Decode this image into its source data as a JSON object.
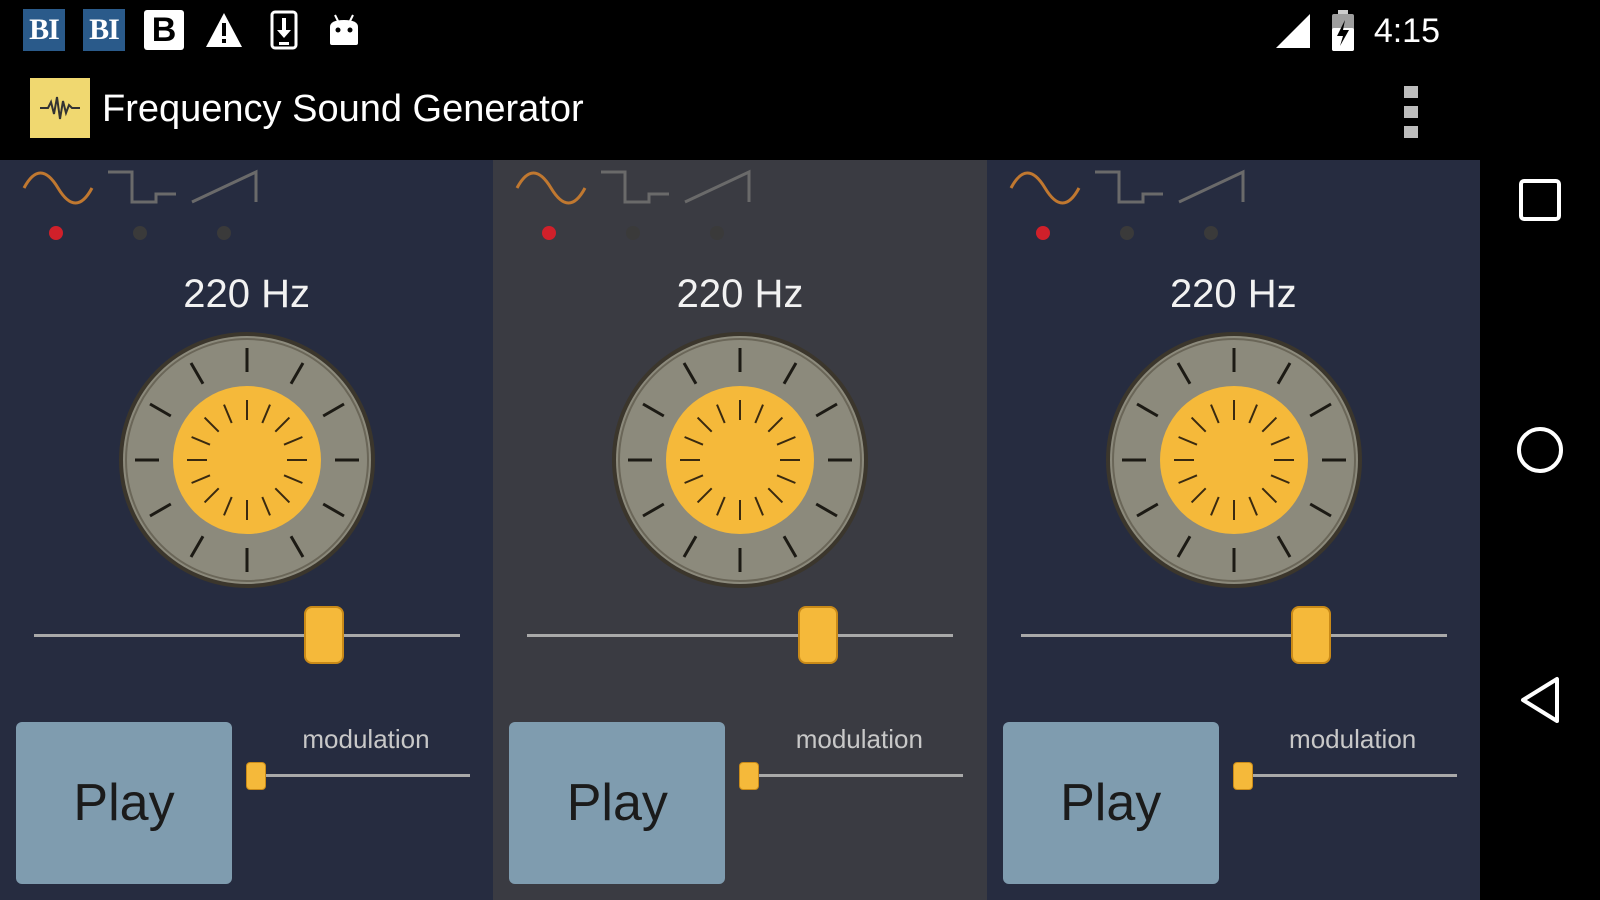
{
  "status_bar": {
    "notifications": [
      {
        "icon": "bi-news-icon",
        "text": "BI"
      },
      {
        "icon": "bi-news-icon",
        "text": "BI"
      },
      {
        "icon": "b-app-icon",
        "text": "B"
      },
      {
        "icon": "warning-icon",
        "text": ""
      },
      {
        "icon": "download-phone-icon",
        "text": ""
      },
      {
        "icon": "android-debug-icon",
        "text": ""
      }
    ],
    "clock": "4:15"
  },
  "action_bar": {
    "title": "Frequency Sound Generator",
    "logo_icon": "waveform-logo-icon"
  },
  "panels": [
    {
      "waveforms": [
        "sine",
        "square",
        "sawtooth"
      ],
      "selected_wave": 0,
      "frequency": "220 Hz",
      "frequency_slider_fraction": 0.7,
      "play_label": "Play",
      "modulation_label": "modulation",
      "modulation_fraction": 0.0
    },
    {
      "waveforms": [
        "sine",
        "square",
        "sawtooth"
      ],
      "selected_wave": 0,
      "frequency": "220 Hz",
      "frequency_slider_fraction": 0.7,
      "play_label": "Play",
      "modulation_label": "modulation",
      "modulation_fraction": 0.0
    },
    {
      "waveforms": [
        "sine",
        "square",
        "sawtooth"
      ],
      "selected_wave": 0,
      "frequency": "220 Hz",
      "frequency_slider_fraction": 0.7,
      "play_label": "Play",
      "modulation_label": "modulation",
      "modulation_fraction": 0.0
    }
  ],
  "colors": {
    "accent": "#f5b93a",
    "wave_active": "#c07830",
    "wave_inactive": "#6a6a6a",
    "dot_active": "#d0202a",
    "dot_inactive": "#3a3a3a",
    "panel_blue": "#262c40",
    "panel_gray": "#3a3b42",
    "play_button": "#7f9caf"
  },
  "nav_bar": {
    "recents_icon": "square-recents-icon",
    "home_icon": "circle-home-icon",
    "back_icon": "triangle-back-icon"
  }
}
